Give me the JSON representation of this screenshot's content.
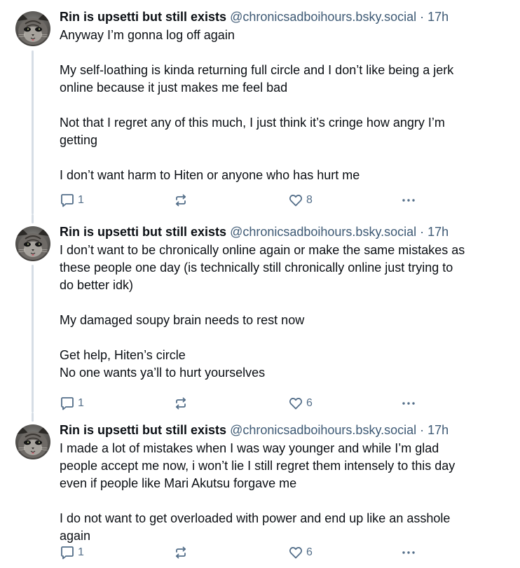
{
  "posts": [
    {
      "display_name": "Rin is upsetti but still exists",
      "handle": "@chronicsadboihours.bsky.social",
      "separator": "·",
      "time": "17h",
      "paragraphs": [
        [
          "Anyway I’m gonna log off again"
        ],
        [
          "My self-loathing is kinda returning full circle and I don’t like being a jerk",
          "online because it just makes me feel bad"
        ],
        [
          "Not that I regret any of this much, I just think it’s cringe how angry I’m",
          "getting"
        ],
        [
          "I don’t want harm to Hiten or anyone who has hurt me"
        ]
      ],
      "reply_count": "1",
      "like_count": "8"
    },
    {
      "display_name": "Rin is upsetti but still exists",
      "handle": "@chronicsadboihours.bsky.social",
      "separator": "·",
      "time": "17h",
      "paragraphs": [
        [
          "I don’t want to be chronically online again or make the same mistakes as",
          "these people one day (is technically still chronically online just trying to",
          "do better idk)"
        ],
        [
          "My damaged soupy brain needs to rest now"
        ],
        [
          "Get help, Hiten’s circle",
          "No one wants ya’ll to hurt yourselves"
        ]
      ],
      "reply_count": "1",
      "like_count": "6"
    },
    {
      "display_name": "Rin is upsetti but still exists",
      "handle": "@chronicsadboihours.bsky.social",
      "separator": "·",
      "time": "17h",
      "paragraphs": [
        [
          "I made a lot of mistakes when I was way younger and while I’m glad",
          "people accept me now, i won’t lie I still regret them intensely to this day",
          "even if people like Mari Akutsu forgave me"
        ],
        [
          "I do not want to get overloaded with power and end up like an asshole",
          "again"
        ]
      ],
      "reply_count": "1",
      "like_count": "6"
    }
  ],
  "icons": {
    "reply": "speech-bubble-icon",
    "repost": "repost-arrows-icon",
    "like": "heart-outline-icon",
    "more": "ellipsis-icon",
    "avatar": "cat-avatar"
  },
  "colors": {
    "text": "#0b0f14",
    "muted": "#3e5a75",
    "icon": "#536e89",
    "thread_line": "#d6dde5"
  }
}
